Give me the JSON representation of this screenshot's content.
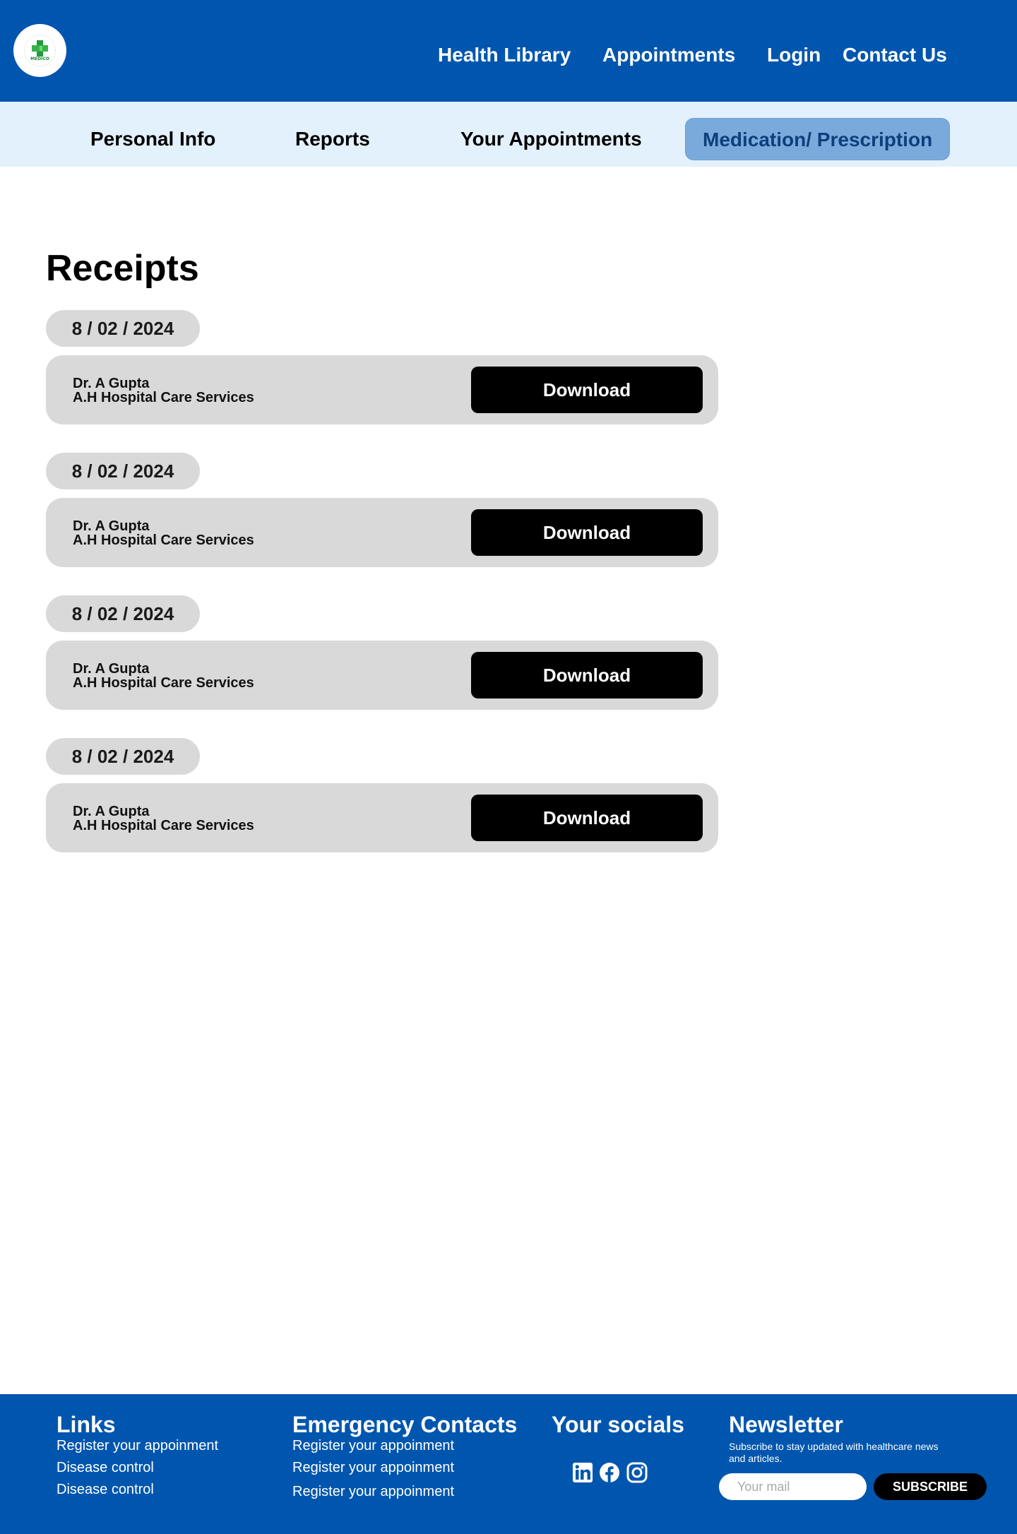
{
  "brand": {
    "logo_text": "MEDICO"
  },
  "topnav": [
    "Health Library",
    "Appointments",
    "Login",
    "Contact Us"
  ],
  "subnav": {
    "tabs": [
      "Personal Info",
      "Reports",
      "Your Appointments",
      "Medication/ Prescription"
    ],
    "active": "Medication/ Prescription"
  },
  "page": {
    "title": "Receipts"
  },
  "receipts": [
    {
      "date": "8 / 02 / 2024",
      "doctor": "Dr. A Gupta",
      "hospital": "A.H Hospital Care Services",
      "action": "Download"
    },
    {
      "date": "8 / 02 / 2024",
      "doctor": "Dr. A Gupta",
      "hospital": "A.H Hospital Care Services",
      "action": "Download"
    },
    {
      "date": "8 / 02 / 2024",
      "doctor": "Dr. A Gupta",
      "hospital": "A.H Hospital Care Services",
      "action": "Download"
    },
    {
      "date": "8 / 02 / 2024",
      "doctor": "Dr. A Gupta",
      "hospital": "A.H Hospital Care Services",
      "action": "Download"
    }
  ],
  "footer": {
    "links": {
      "heading": "Links",
      "items": [
        "Register your appoinment",
        "Disease control",
        "Disease control"
      ]
    },
    "emergency": {
      "heading": "Emergency Contacts",
      "items": [
        "Register your appoinment",
        "Register your appoinment",
        "Register your appoinment"
      ]
    },
    "socials": {
      "heading": "Your socials",
      "icons": [
        "linkedin-icon",
        "facebook-icon",
        "instagram-icon"
      ]
    },
    "newsletter": {
      "heading": "Newsletter",
      "text": "Subscribe to stay updated with healthcare news and articles.",
      "placeholder": "Your mail",
      "button": "SUBSCRIBE"
    }
  },
  "colors": {
    "primary": "#0056ae",
    "subnav_bg": "#e3f1fc",
    "active_tab": "#7aaadb",
    "card": "#d9d9d9"
  }
}
